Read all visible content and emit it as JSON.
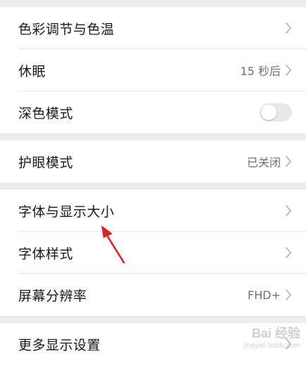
{
  "groups": [
    {
      "rows": [
        {
          "label": "色彩调节与色温",
          "value": "",
          "control": "chevron"
        },
        {
          "label": "休眠",
          "value": "15 秒后",
          "control": "chevron"
        },
        {
          "label": "深色模式",
          "value": "",
          "control": "toggle",
          "toggle_on": false
        }
      ]
    },
    {
      "rows": [
        {
          "label": "护眼模式",
          "value": "已关闭",
          "control": "chevron"
        }
      ]
    },
    {
      "rows": [
        {
          "label": "字体与显示大小",
          "value": "",
          "control": "chevron"
        },
        {
          "label": "字体样式",
          "value": "",
          "control": "chevron"
        },
        {
          "label": "屏幕分辨率",
          "value": "FHD+",
          "control": "chevron"
        }
      ]
    },
    {
      "rows": [
        {
          "label": "更多显示设置",
          "value": "",
          "control": "chevron"
        }
      ]
    }
  ],
  "watermark": {
    "main": "Bai 经验",
    "sub": "jingyan.baidu.com"
  },
  "colors": {
    "arrow": "#e0201b",
    "background": "#ececec",
    "row_background": "#ffffff"
  }
}
